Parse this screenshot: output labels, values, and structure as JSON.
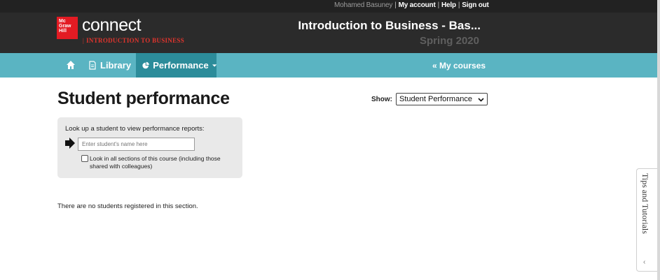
{
  "header": {
    "user_name": "Mohamed Basuney",
    "links": [
      "My account",
      "Help",
      "Sign out"
    ],
    "logo_badge": [
      "Mc",
      "Graw",
      "Hill"
    ],
    "logo_text": "connect",
    "logo_subtitle": "INTRODUCTION TO BUSINESS",
    "course_title": "Introduction to Business - Bas...",
    "course_term": "Spring 2020"
  },
  "nav": {
    "home_icon": "home-icon",
    "library_label": "Library",
    "performance_label": "Performance",
    "my_courses_label": "« My courses"
  },
  "main": {
    "page_title": "Student performance",
    "show_label": "Show:",
    "show_selected": "Student Performance",
    "lookup_label": "Look up a student to view performance reports:",
    "lookup_placeholder": "Enter student's name here",
    "lookup_checkbox_label": "Look in all sections of this course (including those shared with colleagues)",
    "empty_message": "There are no students registered in this section."
  },
  "tips": {
    "label": "Tips and Tutorials",
    "chevron": "‹"
  },
  "colors": {
    "header_bg": "#2b2b2b",
    "nav_bg": "#5ab4c2",
    "nav_active_bg": "#2c8c9a",
    "brand_red": "#e31b23"
  }
}
